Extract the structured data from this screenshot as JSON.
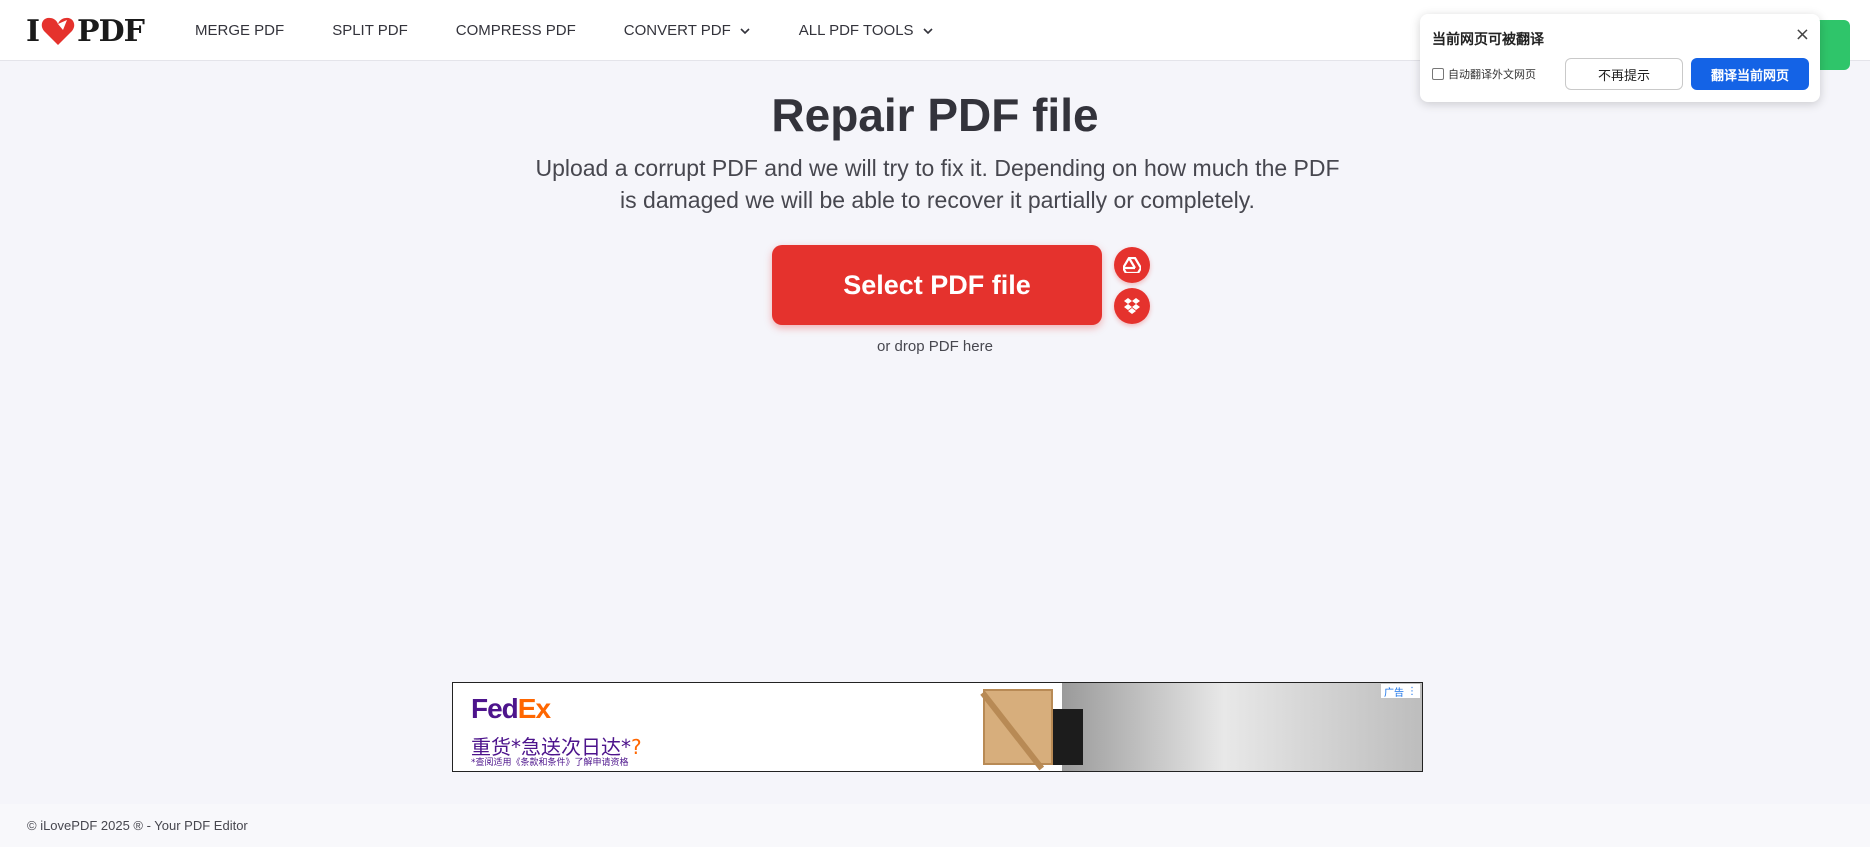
{
  "header": {
    "logo_left": "I",
    "logo_right": "PDF",
    "nav": [
      {
        "label": "MERGE PDF"
      },
      {
        "label": "SPLIT PDF"
      },
      {
        "label": "COMPRESS PDF"
      },
      {
        "label": "CONVERT PDF"
      },
      {
        "label": "ALL PDF TOOLS"
      }
    ]
  },
  "translate_popup": {
    "title": "当前网页可被翻译",
    "close": "×",
    "auto_checkbox_label": "自动翻译外文网页",
    "dismiss_button": "不再提示",
    "translate_button": "翻译当前网页"
  },
  "main": {
    "title": "Repair PDF file",
    "subtitle": "Upload a corrupt PDF and we will try to fix it. Depending on how much the PDF is damaged we will be able to recover it partially or completely.",
    "select_button": "Select PDF file",
    "drop_text": "or drop PDF here",
    "cloud_buttons": [
      "google-drive-icon",
      "dropbox-icon"
    ]
  },
  "ad": {
    "brand_fed": "Fed",
    "brand_ex": "Ex",
    "headline": "重货*急送次日达*",
    "headline_q": "?",
    "note": "*查阅适用《条款和条件》了解申请资格",
    "badge": "广告"
  },
  "footer": {
    "text": "© iLovePDF 2025 ® - Your PDF Editor"
  },
  "colors": {
    "brand_red": "#e5322d",
    "translate_blue": "#1463e6",
    "fedex_purple": "#4d148c",
    "fedex_orange": "#ff6600"
  }
}
